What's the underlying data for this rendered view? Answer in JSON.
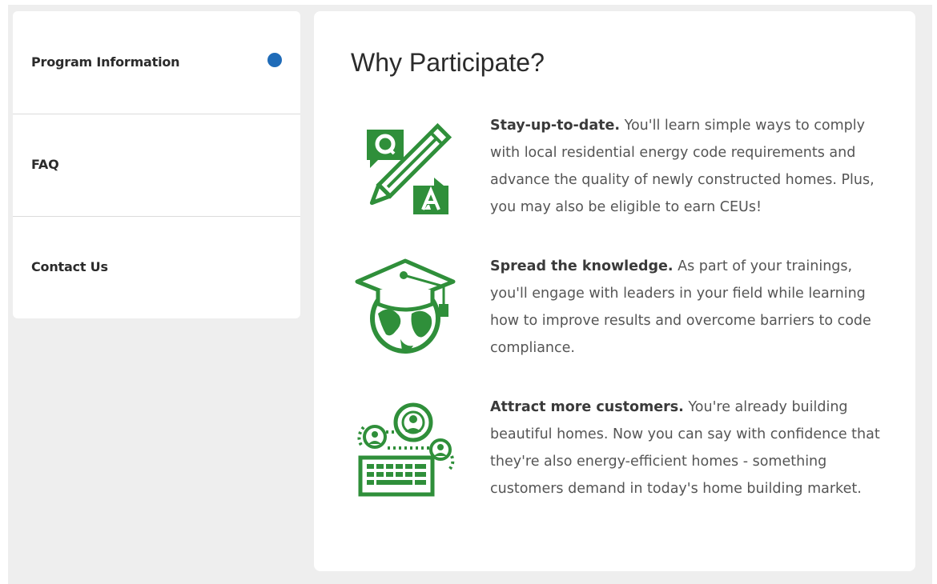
{
  "colors": {
    "accent_green": "#2f8f3a",
    "active_dot": "#1f6bb8",
    "background": "#eeeeee",
    "card": "#ffffff"
  },
  "sidebar": {
    "items": [
      {
        "label": "Program Information",
        "active": true
      },
      {
        "label": "FAQ",
        "active": false
      },
      {
        "label": "Contact Us",
        "active": false
      }
    ]
  },
  "main": {
    "title": "Why Participate?",
    "benefits": [
      {
        "icon": "qa-pencil-icon",
        "heading": "Stay-up-to-date.",
        "body": "You'll learn simple ways to comply with local residential energy code requirements and advance the quality of newly constructed homes. Plus, you may also be eligible to earn CEUs!"
      },
      {
        "icon": "graduation-globe-icon",
        "heading": "Spread the knowledge.",
        "body": "As part of your trainings, you'll engage with leaders in your field while learning how to improve results and overcome barriers to code compliance."
      },
      {
        "icon": "customers-keyboard-icon",
        "heading": "Attract more customers.",
        "body": "You're already building beautiful homes. Now you can say with confidence that they're also energy-efficient homes - something customers demand in today's home building market."
      }
    ]
  }
}
